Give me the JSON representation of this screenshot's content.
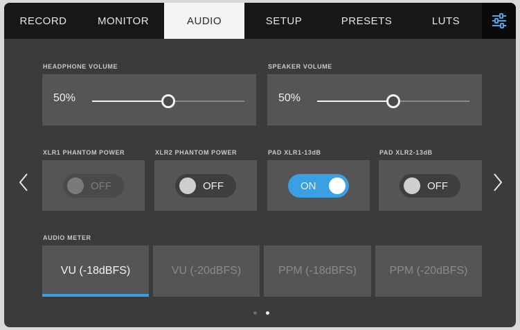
{
  "tabs": [
    {
      "label": "RECORD",
      "active": false
    },
    {
      "label": "MONITOR",
      "active": false
    },
    {
      "label": "AUDIO",
      "active": true
    },
    {
      "label": "SETUP",
      "active": false
    },
    {
      "label": "PRESETS",
      "active": false
    },
    {
      "label": "LUTS",
      "active": false
    }
  ],
  "menu_icon": "sliders-icon",
  "headphone": {
    "label": "HEADPHONE VOLUME",
    "value_text": "50%",
    "level": 0.5
  },
  "speaker": {
    "label": "SPEAKER VOLUME",
    "value_text": "50%",
    "level": 0.5
  },
  "toggles": [
    {
      "label": "XLR1 PHANTOM POWER",
      "state": "OFF",
      "enabled": false
    },
    {
      "label": "XLR2 PHANTOM POWER",
      "state": "OFF",
      "enabled": true
    },
    {
      "label": "PAD XLR1-13dB",
      "state": "ON",
      "enabled": true
    },
    {
      "label": "PAD XLR2-13dB",
      "state": "OFF",
      "enabled": true
    }
  ],
  "audio_meter": {
    "label": "AUDIO METER",
    "options": [
      "VU (-18dBFS)",
      "VU (-20dBFS)",
      "PPM (-18dBFS)",
      "PPM (-20dBFS)"
    ],
    "selected_index": 0
  },
  "page_indicator": {
    "pages": 2,
    "current": 2
  },
  "colors": {
    "accent": "#3a9fe3",
    "panel": "#555555",
    "background": "#3b3b3b"
  }
}
